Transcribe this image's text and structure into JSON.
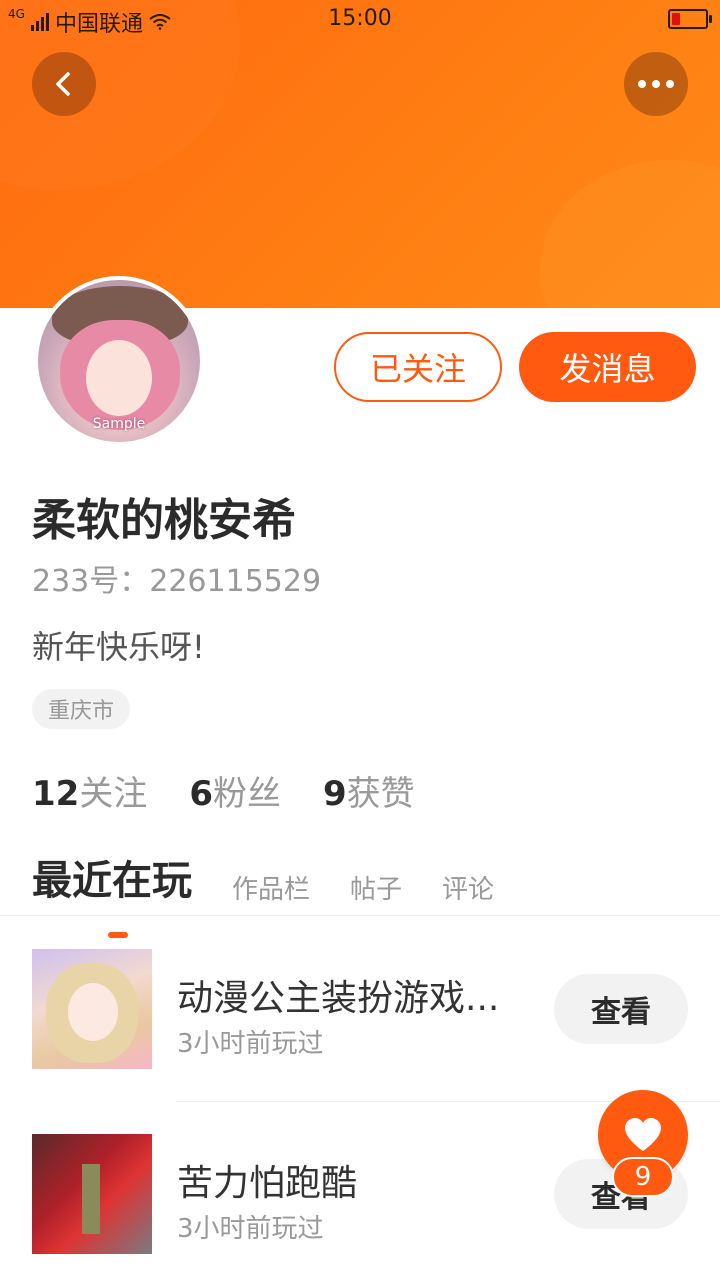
{
  "status_bar": {
    "network": "4G",
    "carrier": "中国联通",
    "time": "15:00"
  },
  "header": {
    "avatar_watermark": "Sample"
  },
  "actions": {
    "follow_label": "已关注",
    "message_label": "发消息"
  },
  "profile": {
    "name": "柔软的桃安希",
    "uid": "233号：226115529",
    "bio": "新年快乐呀!",
    "location": "重庆市"
  },
  "stats": [
    {
      "num": "12",
      "label": "关注"
    },
    {
      "num": "6",
      "label": "粉丝"
    },
    {
      "num": "9",
      "label": "获赞"
    }
  ],
  "tabs": [
    {
      "label": "最近在玩"
    },
    {
      "label": "作品栏"
    },
    {
      "label": "帖子"
    },
    {
      "label": "评论"
    }
  ],
  "games": [
    {
      "title": "动漫公主装扮游戏...",
      "subtitle": "3小时前玩过",
      "button": "查看"
    },
    {
      "title": "苦力怕跑酷",
      "subtitle": "3小时前玩过",
      "button": "查看"
    }
  ],
  "like": {
    "count": "9"
  },
  "colors": {
    "accent": "#ff5a10",
    "banner": "#ff7d12"
  },
  "icons": [
    "signal-icon",
    "wifi-icon",
    "battery-icon",
    "back-icon",
    "more-icon",
    "heart-icon"
  ]
}
